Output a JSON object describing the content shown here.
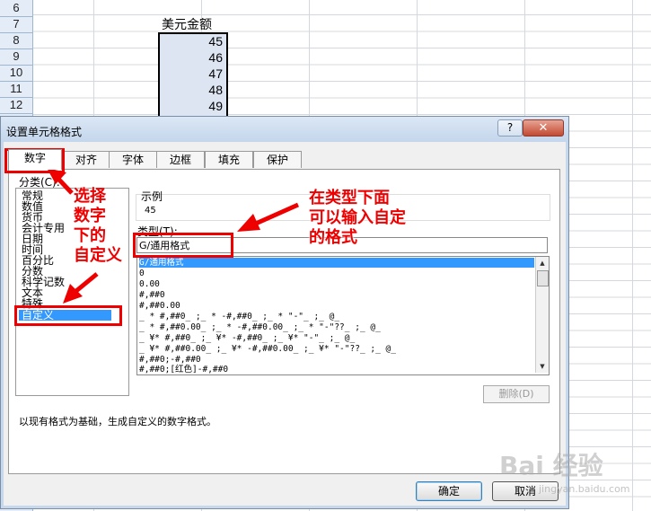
{
  "spreadsheet": {
    "rows": [
      "6",
      "7",
      "8",
      "9",
      "10",
      "11",
      "12"
    ],
    "header_cell": "美元金额",
    "values": [
      "45",
      "46",
      "47",
      "48",
      "49"
    ]
  },
  "dialog": {
    "title": "设置单元格格式",
    "help": "?",
    "close": "✕",
    "tabs": [
      "数字",
      "对齐",
      "字体",
      "边框",
      "填充",
      "保护"
    ],
    "category_label": "分类(C):",
    "categories": [
      "常规",
      "数值",
      "货币",
      "会计专用",
      "日期",
      "时间",
      "百分比",
      "分数",
      "科学记数",
      "文本",
      "特殊",
      "自定义"
    ],
    "sample_label": "示例",
    "sample_value": "45",
    "type_label": "类型(T):",
    "type_value": "G/通用格式",
    "formats": [
      "G/通用格式",
      "0",
      "0.00",
      "#,##0",
      "#,##0.00",
      "_ * #,##0_ ;_ * -#,##0_ ;_ * \"-\"_ ;_ @_",
      "_ * #,##0.00_ ;_ * -#,##0.00_ ;_ * \"-\"??_ ;_ @_",
      "_ ¥* #,##0_ ;_ ¥* -#,##0_ ;_ ¥* \"-\"_ ;_ @_",
      "_ ¥* #,##0.00_ ;_ ¥* -#,##0.00_ ;_ ¥* \"-\"??_ ;_ @_",
      "#,##0;-#,##0",
      "#,##0;[红色]-#,##0"
    ],
    "delete_button": "删除(D)",
    "description": "以现有格式为基础，生成自定义的数字格式。",
    "ok_button": "确定",
    "cancel_button": "取消"
  },
  "annotations": {
    "left_text": "选择\n数字\n下的\n自定义",
    "right_text": "在类型下面\n可以输入自定\n的格式",
    "color": "#e00000"
  },
  "watermark": {
    "main": "Bai 经验",
    "sub": "jingyan.baidu.com"
  }
}
